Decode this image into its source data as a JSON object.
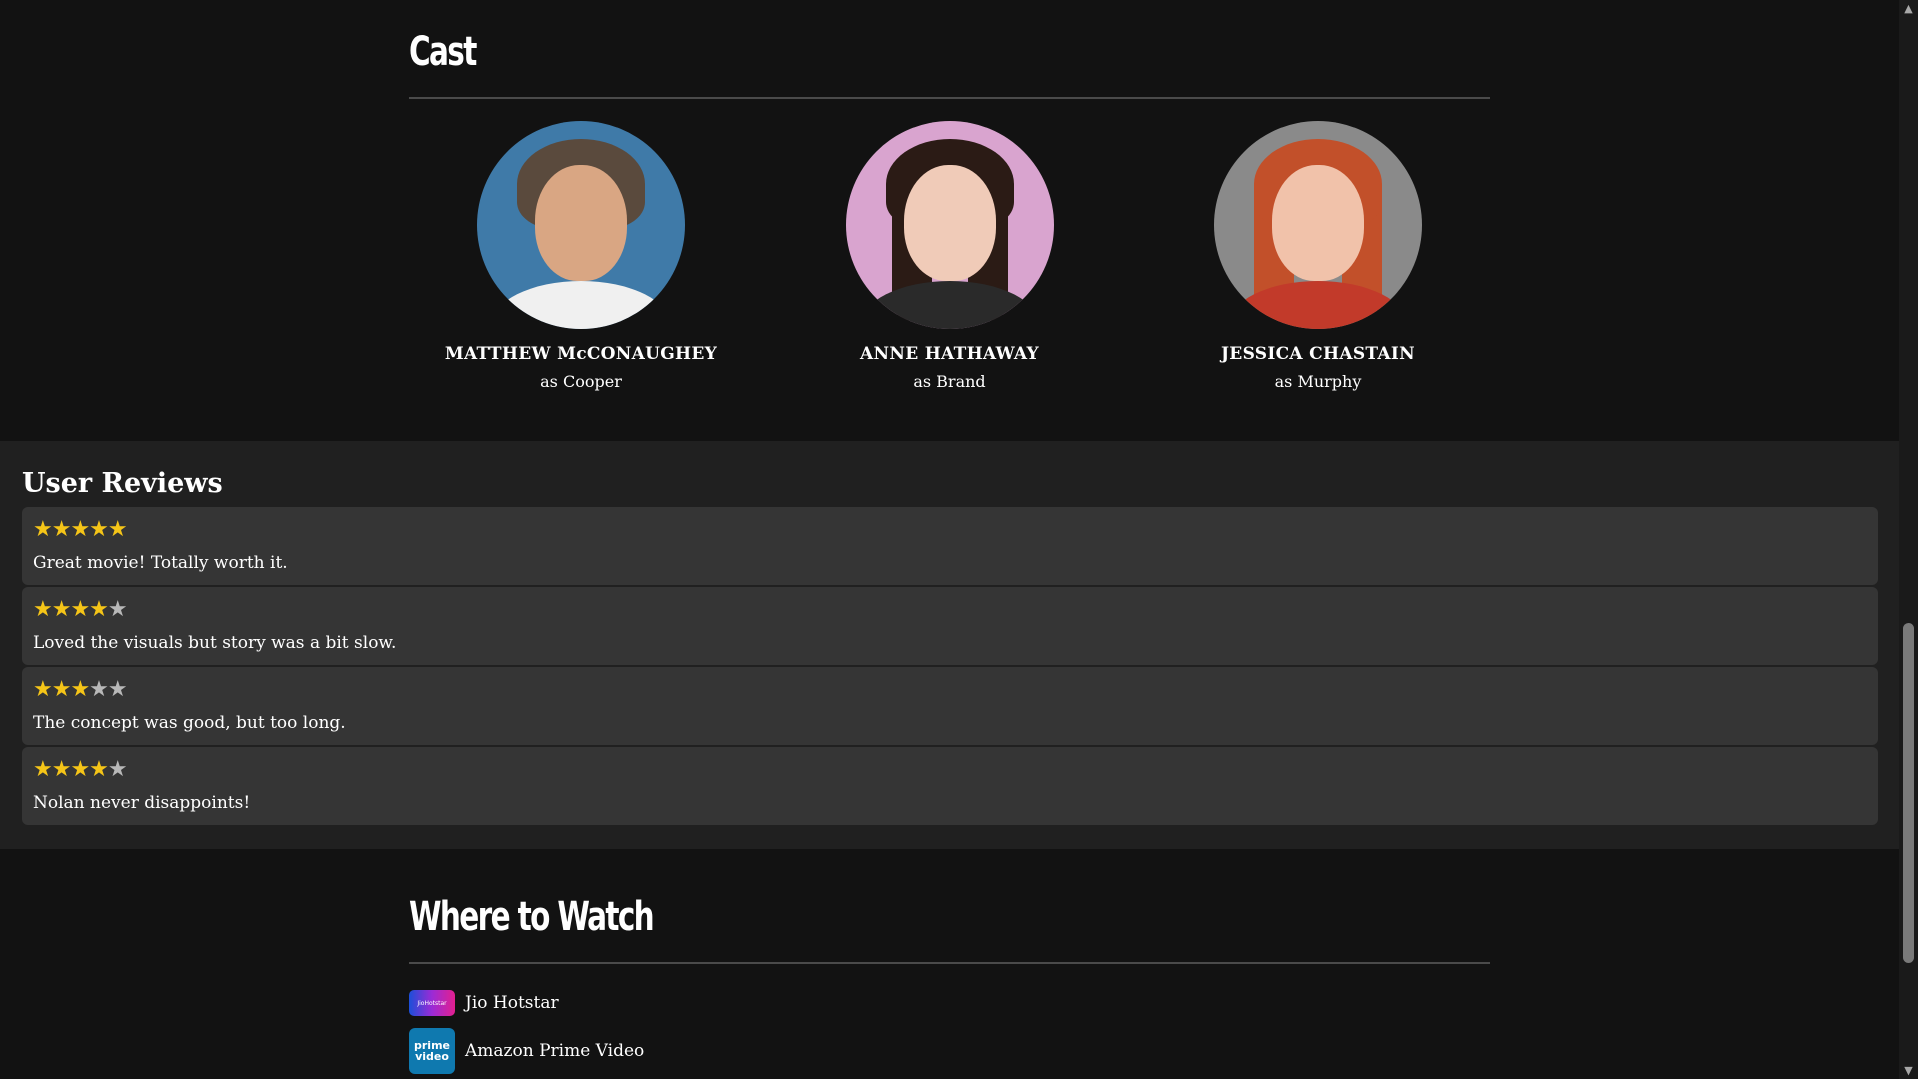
{
  "cast": {
    "title": "Cast",
    "members": [
      {
        "name": "MATTHEW McCONAUGHEY",
        "role": "as Cooper",
        "photo": "matthew-mcconaughey-photo",
        "bg": "#3f7aa8",
        "skin": "#d9a683",
        "hair": "#5a4a3d",
        "shirt": "#f0f0f0"
      },
      {
        "name": "ANNE HATHAWAY",
        "role": "as Brand",
        "photo": "anne-hathaway-photo",
        "bg": "#d9a4cf",
        "skin": "#f0cbb8",
        "hair": "#2b1b15",
        "shirt": "#2a2a2a"
      },
      {
        "name": "JESSICA CHASTAIN",
        "role": "as Murphy",
        "photo": "jessica-chastain-photo",
        "bg": "#8a8a8a",
        "skin": "#f1c2aa",
        "hair": "#c2502a",
        "shirt": "#c23a2a"
      }
    ]
  },
  "reviews": {
    "title": "User Reviews",
    "items": [
      {
        "stars": "★★★★★",
        "empty": "",
        "rating": 5,
        "text": "Great movie! Totally worth it."
      },
      {
        "stars": "★★★★",
        "empty": "★",
        "rating": 4,
        "text": "Loved the visuals but story was a bit slow."
      },
      {
        "stars": "★★★",
        "empty": "★★",
        "rating": 3,
        "text": "The concept was good, but too long."
      },
      {
        "stars": "★★★★",
        "empty": "★",
        "rating": 4,
        "text": "Nolan never disappoints!"
      }
    ]
  },
  "watch": {
    "title": "Where to Watch",
    "providers": [
      {
        "name": "Jio Hotstar",
        "icon": "jiohotstar-logo",
        "logo_text": "JioHotstar"
      },
      {
        "name": "Amazon Prime Video",
        "icon": "prime-video-logo",
        "logo_text_1": "prime",
        "logo_text_2": "video"
      }
    ]
  },
  "colors": {
    "star": "#f5c518",
    "background": "#121212",
    "reviews_panel": "#202020",
    "review_card": "#353535"
  },
  "scrollbar": {
    "position_fraction": 0.58
  }
}
